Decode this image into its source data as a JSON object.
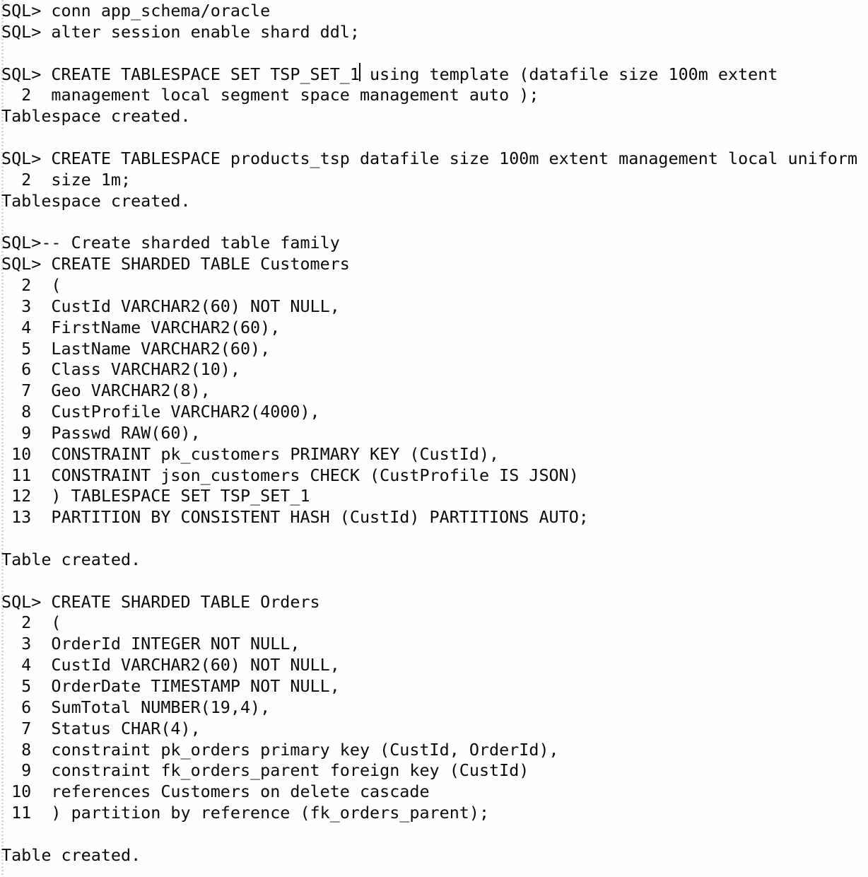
{
  "terminal": {
    "window_title": "SQL*Plus Terminal",
    "prompt": "SQL>",
    "background_color": "#fffdfe",
    "text_color": "#0a0a0a",
    "caret": {
      "visible": true,
      "after_text": "TSP_SET_1",
      "line_index": 3,
      "color": "#0a0a0a"
    },
    "lines": [
      "SQL> conn app_schema/oracle",
      "SQL> alter session enable shard ddl;",
      "",
      "SQL> CREATE TABLESPACE SET TSP_SET_1 using template (datafile size 100m extent",
      "  2  management local segment space management auto );",
      "Tablespace created.",
      "",
      "SQL> CREATE TABLESPACE products_tsp datafile size 100m extent management local uniform",
      "  2  size 1m;",
      "Tablespace created.",
      "",
      "SQL>-- Create sharded table family",
      "SQL> CREATE SHARDED TABLE Customers",
      "  2  (",
      "  3  CustId VARCHAR2(60) NOT NULL,",
      "  4  FirstName VARCHAR2(60),",
      "  5  LastName VARCHAR2(60),",
      "  6  Class VARCHAR2(10),",
      "  7  Geo VARCHAR2(8),",
      "  8  CustProfile VARCHAR2(4000),",
      "  9  Passwd RAW(60),",
      " 10  CONSTRAINT pk_customers PRIMARY KEY (CustId),",
      " 11  CONSTRAINT json_customers CHECK (CustProfile IS JSON)",
      " 12  ) TABLESPACE SET TSP_SET_1",
      " 13  PARTITION BY CONSISTENT HASH (CustId) PARTITIONS AUTO;",
      "",
      "Table created.",
      "",
      "SQL> CREATE SHARDED TABLE Orders",
      "  2  (",
      "  3  OrderId INTEGER NOT NULL,",
      "  4  CustId VARCHAR2(60) NOT NULL,",
      "  5  OrderDate TIMESTAMP NOT NULL,",
      "  6  SumTotal NUMBER(19,4),",
      "  7  Status CHAR(4),",
      "  8  constraint pk_orders primary key (CustId, OrderId),",
      "  9  constraint fk_orders_parent foreign key (CustId)",
      " 10  references Customers on delete cascade",
      " 11  ) partition by reference (fk_orders_parent);",
      "",
      "Table created."
    ]
  }
}
